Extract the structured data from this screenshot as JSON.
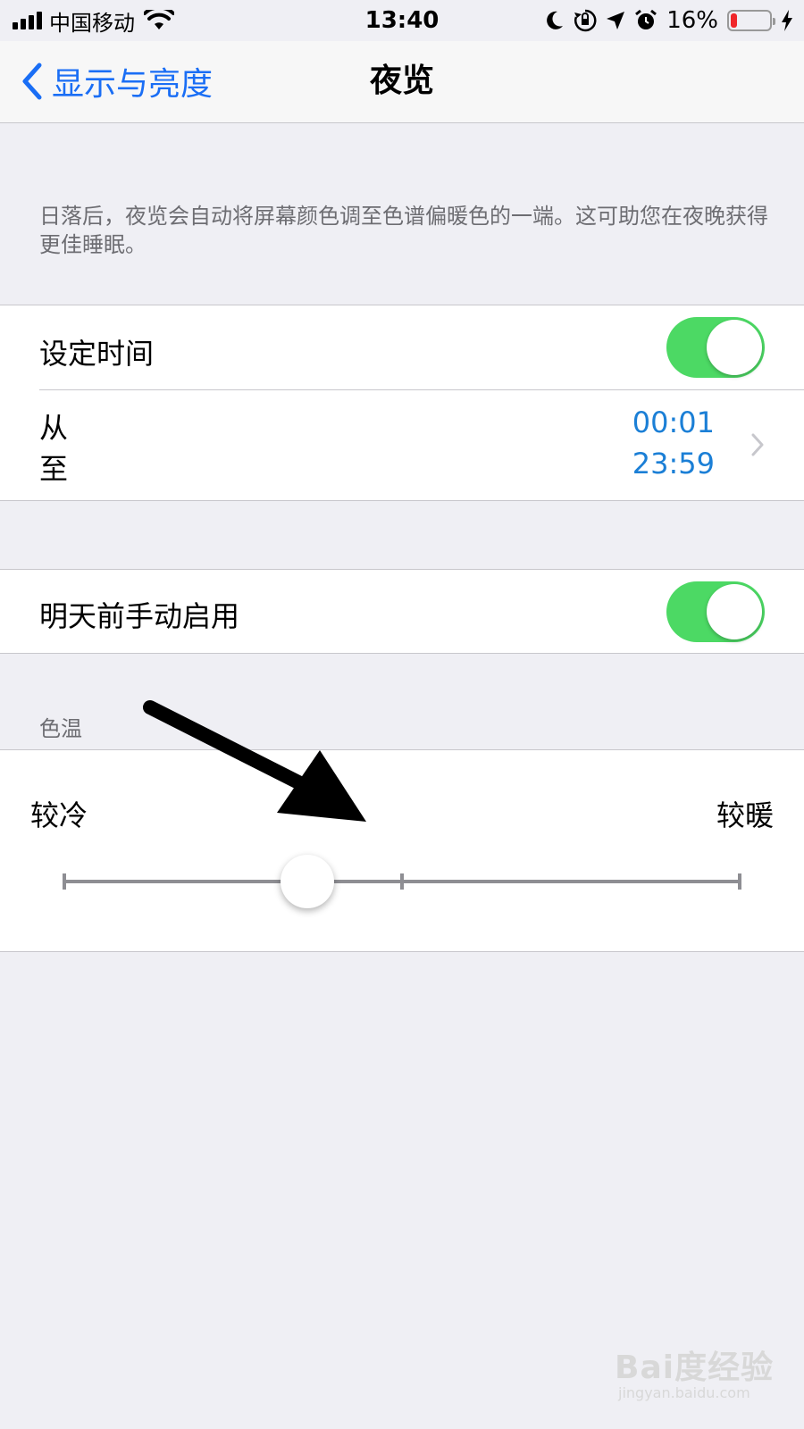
{
  "status_bar": {
    "carrier": "中国移动",
    "time": "13:40",
    "battery_percent": "16%",
    "battery_level": 0.16,
    "icons": [
      "signal-icon",
      "wifi-icon",
      "moon-icon",
      "rotation-lock-icon",
      "location-icon",
      "alarm-icon",
      "battery-icon",
      "charging-icon"
    ]
  },
  "nav": {
    "back_label": "显示与亮度",
    "title": "夜览"
  },
  "description": "日落后，夜览会自动将屏幕颜色调至色谱偏暖色的一端。这可助您在夜晚获得更佳睡眠。",
  "scheduled": {
    "label": "设定时间",
    "enabled": true,
    "from_label": "从",
    "to_label": "至",
    "from_time": "00:01",
    "to_time": "23:59"
  },
  "manual": {
    "label": "明天前手动启用",
    "enabled": true
  },
  "color_temp": {
    "header": "色温",
    "cooler_label": "较冷",
    "warmer_label": "较暖",
    "value": 0.36
  },
  "watermark": {
    "text": "Bai度经验",
    "url": "jingyan.baidu.com"
  },
  "colors": {
    "accent": "#1a6ef5",
    "switch_on": "#4cd964",
    "time_blue": "#1b7fd6",
    "background": "#efeff4"
  }
}
